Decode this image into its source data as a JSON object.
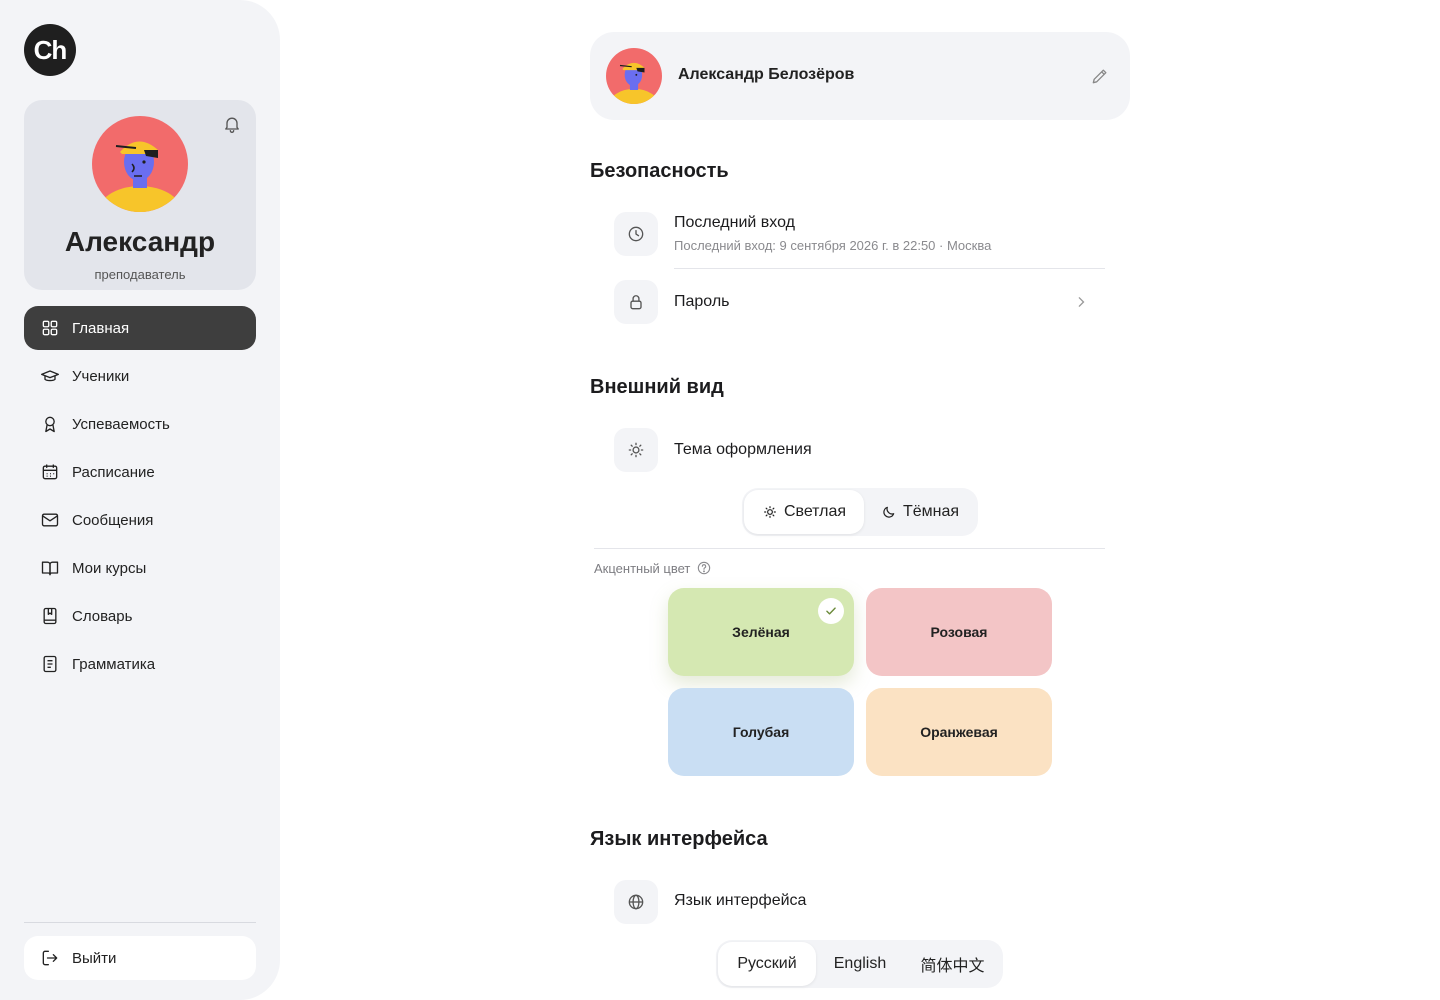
{
  "app": {
    "logo_text": "Ch"
  },
  "profile": {
    "name": "Александр",
    "role": "преподаватель"
  },
  "nav": {
    "items": [
      {
        "label": "Главная",
        "icon": "grid-icon",
        "active": true
      },
      {
        "label": "Ученики",
        "icon": "graduation-cap-icon"
      },
      {
        "label": "Успеваемость",
        "icon": "award-icon"
      },
      {
        "label": "Расписание",
        "icon": "calendar-icon"
      },
      {
        "label": "Сообщения",
        "icon": "mail-icon"
      },
      {
        "label": "Мои курсы",
        "icon": "book-open-icon"
      },
      {
        "label": "Словарь",
        "icon": "dictionary-icon"
      },
      {
        "label": "Грамматика",
        "icon": "document-icon"
      }
    ],
    "logout_label": "Выйти"
  },
  "header": {
    "full_name": "Александр Белозёров"
  },
  "security": {
    "title": "Безопасность",
    "last_login_title": "Последний вход",
    "last_login_detail": "Последний вход: 9 сентября 2026 г. в 22:50 · Москва",
    "password_label": "Пароль"
  },
  "appearance": {
    "title": "Внешний вид",
    "theme_label": "Тема оформления",
    "theme_light": "Светлая",
    "theme_dark": "Тёмная",
    "theme_selected": "Светлая",
    "accent_label": "Акцентный цвет",
    "accents": [
      {
        "label": "Зелёная",
        "color": "#d5e8b2",
        "selected": true
      },
      {
        "label": "Розовая",
        "color": "#f3c5c6"
      },
      {
        "label": "Голубая",
        "color": "#c9def3"
      },
      {
        "label": "Оранжевая",
        "color": "#fbe2c3"
      }
    ]
  },
  "language": {
    "title": "Язык интерфейса",
    "row_label": "Язык интерфейса",
    "options": [
      "Русский",
      "English",
      "简体中文"
    ],
    "selected": "Русский"
  },
  "colors": {
    "active_nav": "#3e3e3e",
    "sidebar_bg": "#f3f4f7",
    "avatar_bg": "#f26b6b"
  }
}
